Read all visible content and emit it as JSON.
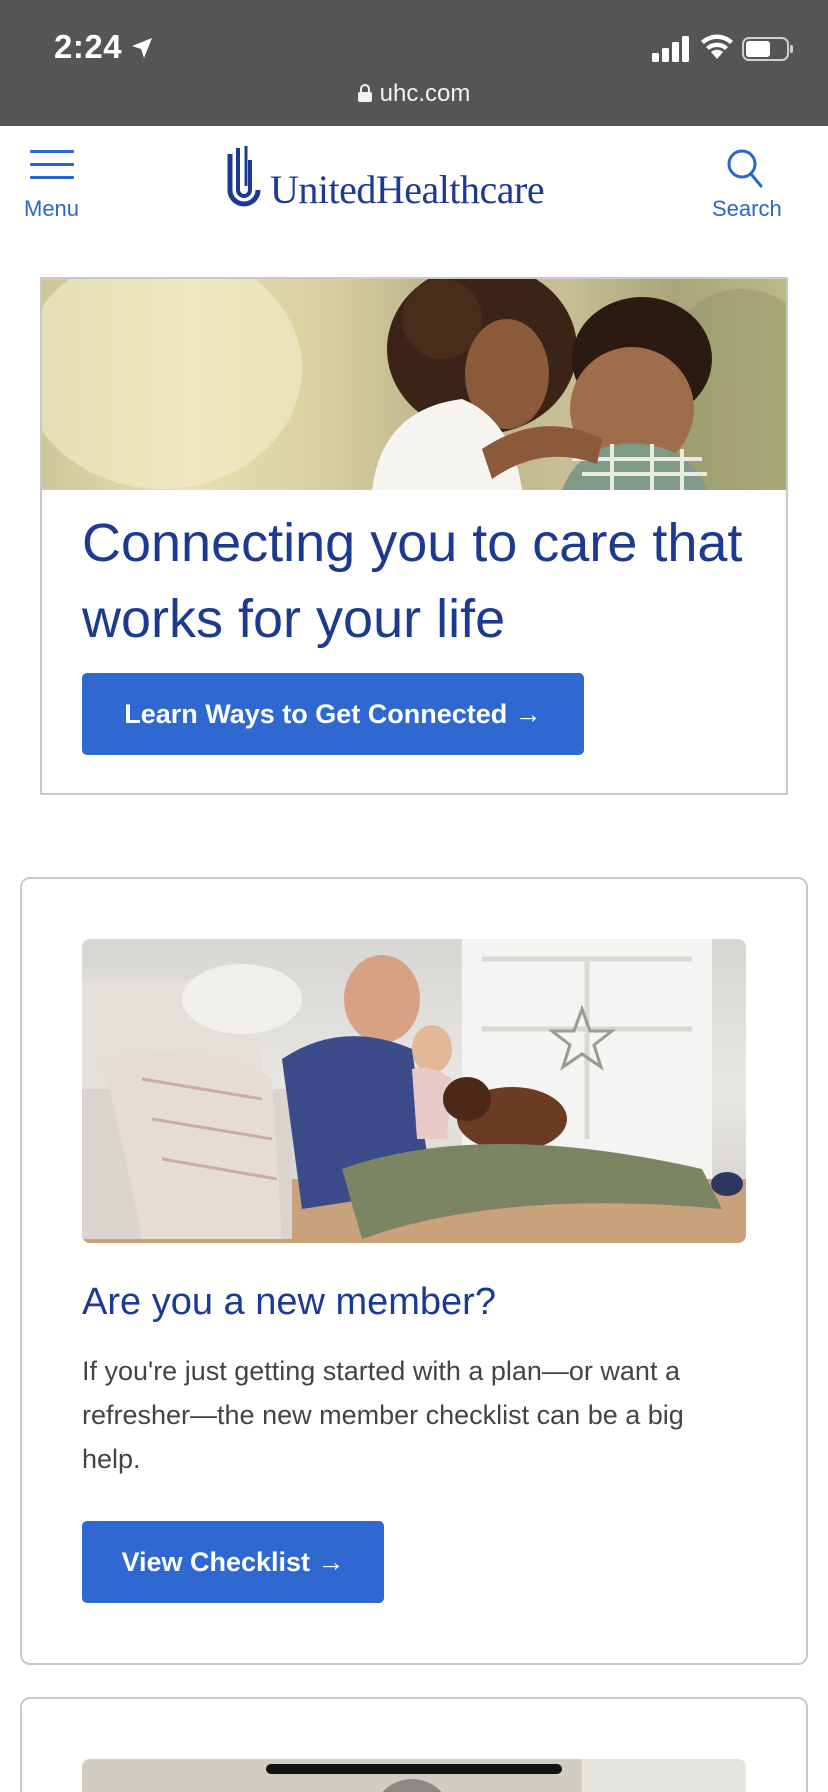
{
  "status_bar": {
    "time": "2:24",
    "url": "uhc.com"
  },
  "header": {
    "menu_label": "Menu",
    "logo_text": "UnitedHealthcare",
    "search_label": "Search"
  },
  "hero": {
    "title": "Connecting you to care that works for your life",
    "button_label": "Learn Ways to Get Connected →"
  },
  "member_card": {
    "title": "Are you a new member?",
    "text": "If you're just getting started with a plan—or want a refresher—the new member checklist can be a big help.",
    "button_label": "View Checklist →"
  },
  "colors": {
    "brand_blue": "#1d3a93",
    "button_blue": "#2e68d0",
    "link_blue": "#2a66cf",
    "status_bar": "#555555"
  }
}
